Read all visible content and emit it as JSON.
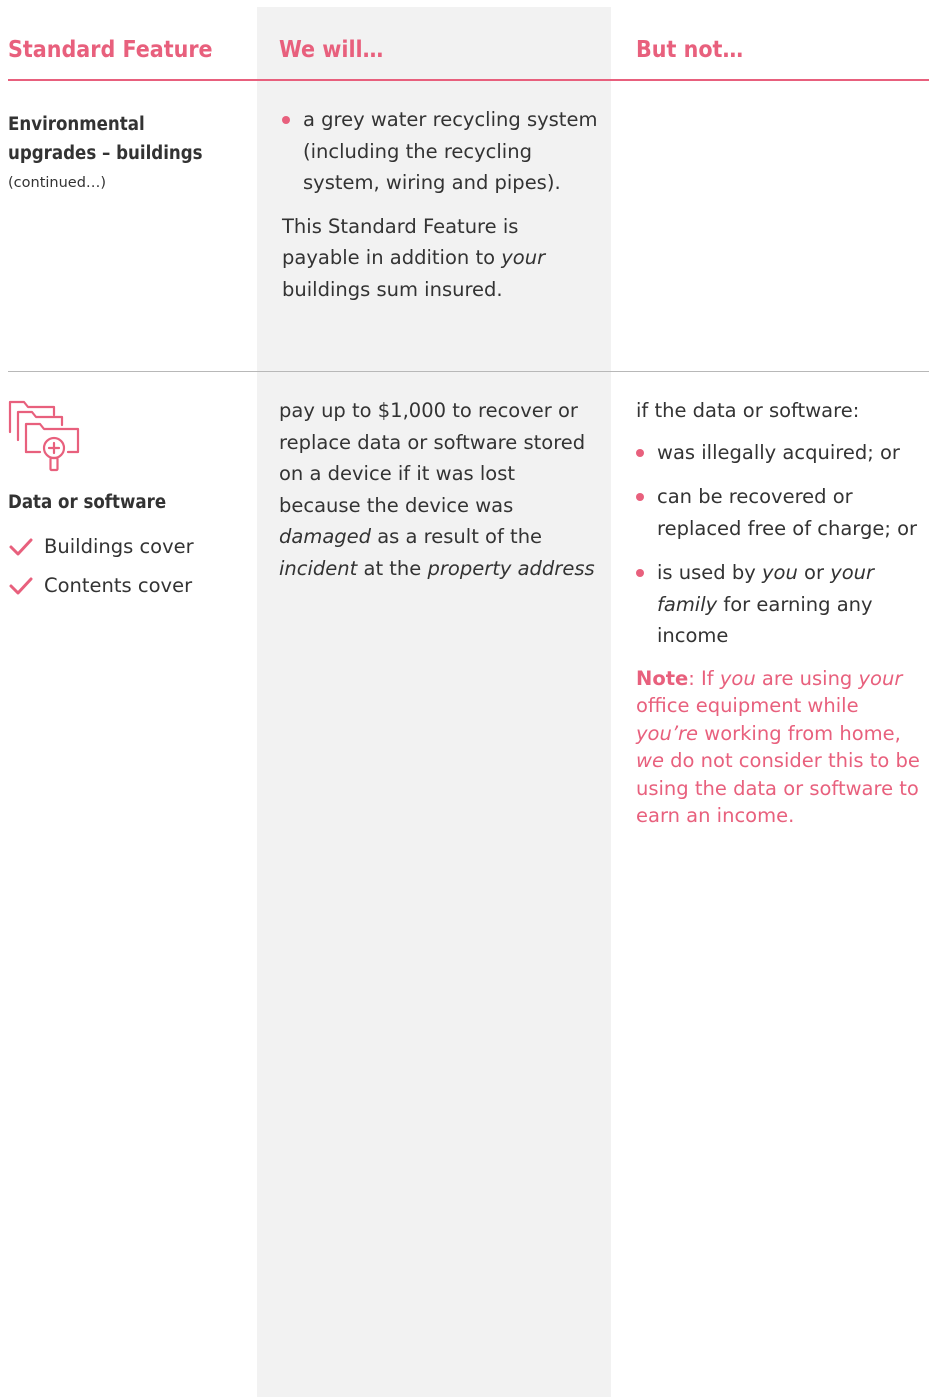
{
  "header": {
    "col1": "Standard Feature",
    "col2": "We will…",
    "col3": "But not…"
  },
  "colors": {
    "accent": "#e8607d",
    "shade": "#f2f2f2",
    "text": "#333333"
  },
  "row1": {
    "title_line1": "Environmental",
    "title_line2": "upgrades – buildings",
    "continued": "(continued…)",
    "bullet": "a grey water recycling system (including the recycling system, wiring and pipes).",
    "para_a": "This Standard Feature is payable in addition to ",
    "para_em": "your",
    "para_b": " buildings sum insured."
  },
  "row2": {
    "icon": "folders-magnifier-icon",
    "title": "Data or software",
    "covers": [
      "Buildings cover",
      "Contents cover"
    ],
    "will_a": "pay up to $1,000 to recover or replace data or software stored on a device if it was lost because the device was ",
    "will_em1": "damaged",
    "will_b": " as a result of the ",
    "will_em2": "incident",
    "will_c": " at the ",
    "will_em3": "property address",
    "not_intro": "if the data or software:",
    "not_b1": "was illegally acquired; or",
    "not_b2": "can be recovered or replaced free of charge; or",
    "not_b3_a": "is used by ",
    "not_b3_em1": "you",
    "not_b3_b": " or ",
    "not_b3_em2": "your family",
    "not_b3_c": " for earning any income",
    "note_label": "Note",
    "note_a": ": If ",
    "note_em1": "you",
    "note_b": " are using ",
    "note_em2": "your",
    "note_c": " office equipment while ",
    "note_em3": "you’re",
    "note_d": " working from home, ",
    "note_em4": "we",
    "note_e": " do not consider this to be using the data or software to earn an income."
  }
}
